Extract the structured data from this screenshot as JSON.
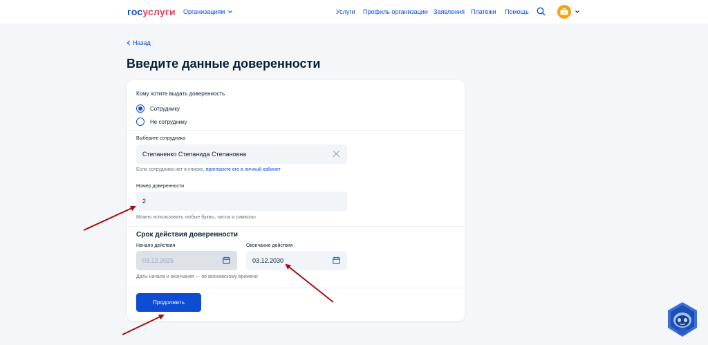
{
  "header": {
    "logo_part1": "гос",
    "logo_part2": "услуги",
    "org_menu_label": "Организациям",
    "nav": [
      "Услуги",
      "Профиль организации",
      "Заявления",
      "Платежи",
      "Помощь"
    ]
  },
  "back_label": "Назад",
  "page_title": "Введите данные доверенности",
  "form": {
    "recipient_label": "Кому хотите выдать доверенность",
    "radio_employee": "Сотруднику",
    "radio_non_employee": "Не сотруднику",
    "employee_label": "Выберите сотрудника",
    "employee_value": "Степаненко Степанида Степановна",
    "employee_hint": "Если сотрудника нет в списке,",
    "employee_hint_link": "пригласите его в личный кабинет",
    "number_label": "Номер доверенности",
    "number_value": "2",
    "number_hint": "Можно использовать любые буквы, числа и символы",
    "validity_title": "Срок действия доверенности",
    "start_label": "Начало действия",
    "start_value": "03.12.2025",
    "end_label": "Окончание действия",
    "end_value": "03.12.2030",
    "dates_hint": "Даты начала и окончания — по московскому времени",
    "submit_label": "Продолжить"
  },
  "colors": {
    "accent": "#0d4cd3",
    "logo_red": "#ee3f58",
    "annotation_arrow": "#a30d0d",
    "avatar": "#f7a215"
  }
}
